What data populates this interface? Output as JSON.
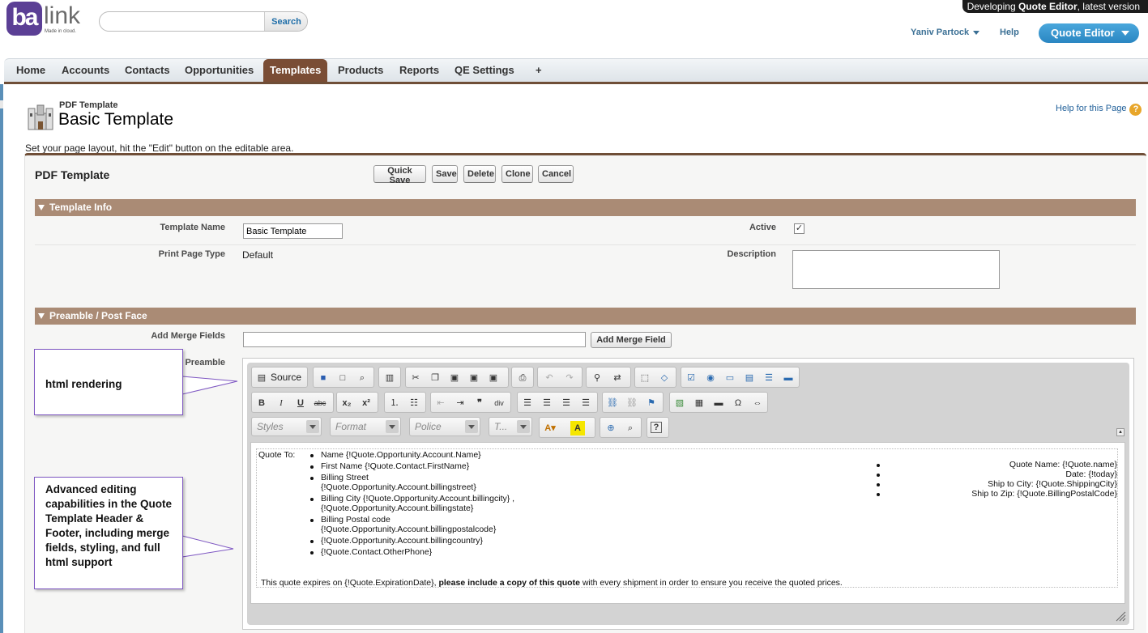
{
  "brand": {
    "logo_ba": "ba",
    "logo_link": "link",
    "tagline": "Made in cloud."
  },
  "search": {
    "placeholder": "",
    "button": "Search"
  },
  "banner": {
    "prefix": "Developing ",
    "app": "Quote Editor",
    "suffix": ", latest version"
  },
  "header": {
    "user": "Yaniv Partock",
    "help": "Help",
    "app_menu": "Quote Editor"
  },
  "tabs": [
    "Home",
    "Accounts",
    "Contacts",
    "Opportunities",
    "Templates",
    "Products",
    "Reports",
    "QE Settings",
    "+"
  ],
  "active_tab": "Templates",
  "page": {
    "type": "PDF Template",
    "title": "Basic Template",
    "help": "Help for this Page",
    "intro": "Set your page layout, hit the \"Edit\" button on the editable area."
  },
  "detail": {
    "title": "PDF Template",
    "buttons": [
      "Quick Save",
      "Save",
      "Delete",
      "Clone",
      "Cancel"
    ]
  },
  "template_info": {
    "heading": "Template Info",
    "template_name_label": "Template Name",
    "template_name_value": "Basic Template",
    "active_label": "Active",
    "active_checked": true,
    "print_type_label": "Print Page Type",
    "print_type_value": "Default",
    "description_label": "Description"
  },
  "preamble": {
    "heading": "Preamble / Post Face",
    "merge_label": "Add Merge Fields",
    "merge_button": "Add Merge Field",
    "preamble_label": "Preamble"
  },
  "editor": {
    "source_label": "Source",
    "combos": [
      "Styles",
      "Format",
      "Police",
      "T..."
    ],
    "quote_to": "Quote To:",
    "left_items": [
      [
        "Name {!Quote.Opportunity.Account.Name}"
      ],
      [
        "First Name {!Quote.Contact.FirstName}"
      ],
      [
        "Billing Street",
        "{!Quote.Opportunity.Account.billingstreet}"
      ],
      [
        "Billing City {!Quote.Opportunity.Account.billingcity} ,",
        "{!Quote.Opportunity.Account.billingstate}"
      ],
      [
        "Billing Postal code",
        "{!Quote.Opportunity.Account.billingpostalcode}"
      ],
      [
        "{!Quote.Opportunity.Account.billingcountry}"
      ],
      [
        "{!Quote.Contact.OtherPhone}"
      ]
    ],
    "right_items": [
      "Quote Name: {!Quote.name}",
      "Date: {!today}",
      "Ship to City: {!Quote.ShippingCity}",
      "Ship to Zip: {!Quote.BillingPostalCode}"
    ],
    "footer_a": "This quote expires on {!Quote.ExpirationDate}, ",
    "footer_b": "please include a copy of this quote",
    "footer_c": " with every shipment in order to ensure you receive the quoted prices."
  },
  "callouts": {
    "html": "html rendering",
    "advanced": "Advanced editing capabilities in the Quote Template Header & Footer, including merge fields, styling, and full html support"
  },
  "colors": {
    "accent": "#7a4d35",
    "section": "#aa8b75",
    "app_button": "#2a86c2",
    "brand": "#5b3f95"
  }
}
